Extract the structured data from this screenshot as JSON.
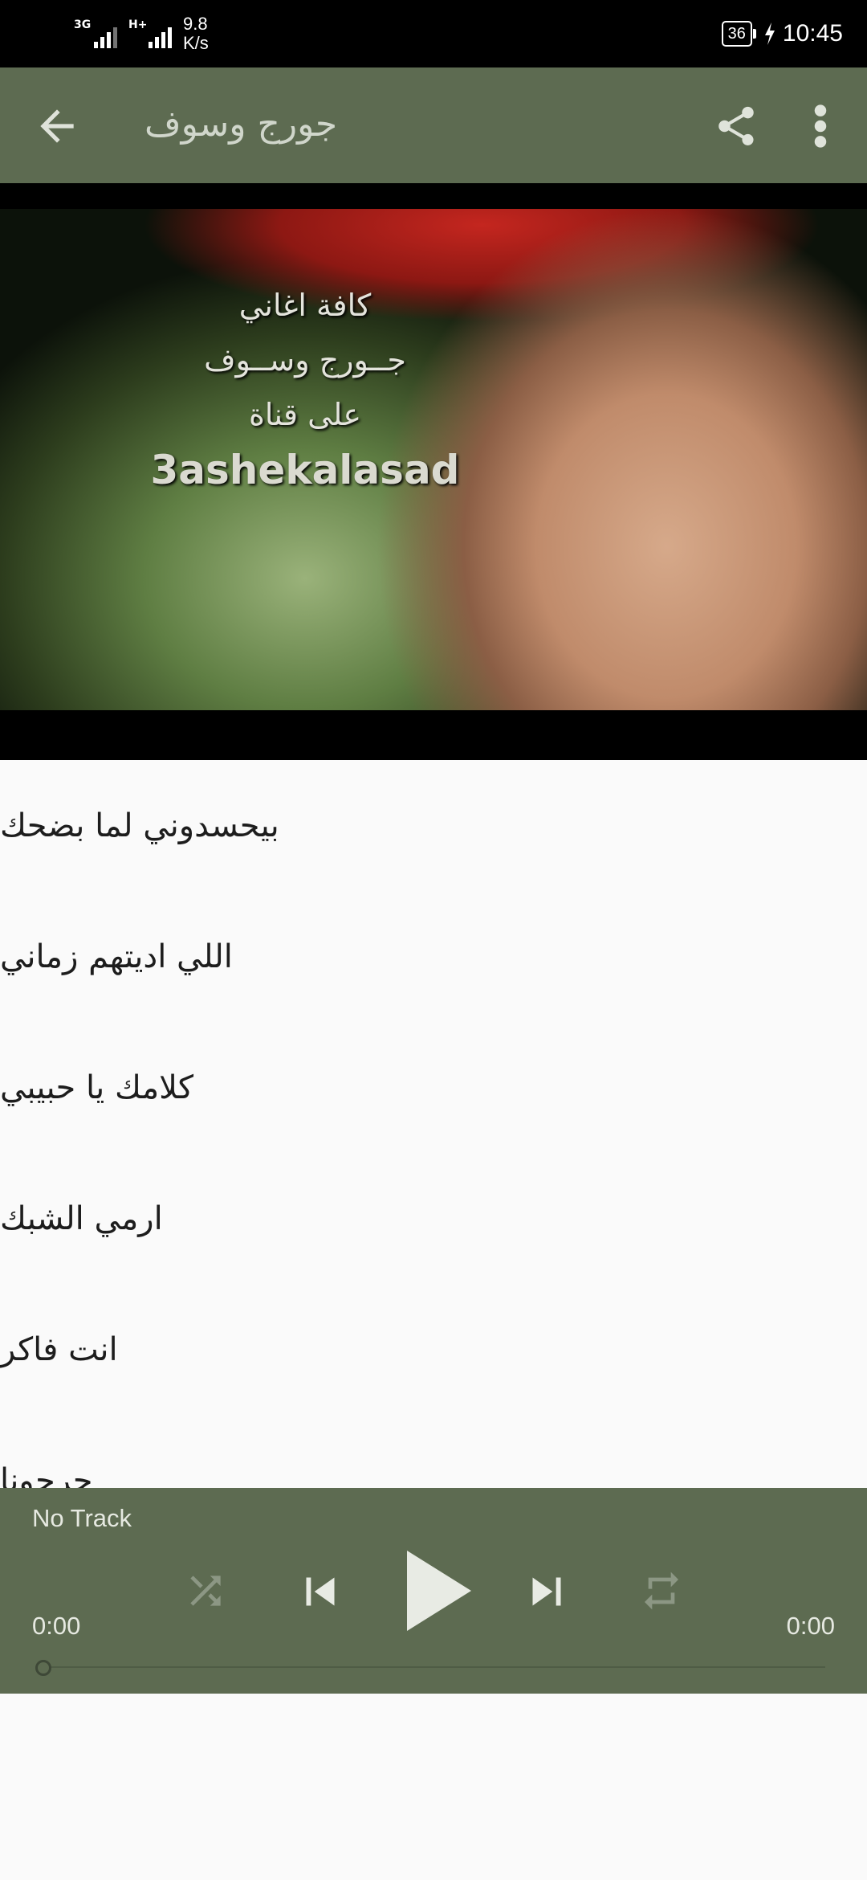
{
  "status_bar": {
    "signal1": "3G",
    "signal2": "H+",
    "net_speed_value": "9.8",
    "net_speed_unit": "K/s",
    "battery": "36",
    "time": "10:45"
  },
  "app_bar": {
    "title": "جورج وسوف",
    "icons": [
      "back-arrow-icon",
      "share-icon",
      "more-vert-icon"
    ]
  },
  "hero": {
    "line1": "كافة اغاني",
    "line2": "جــورج وســوف",
    "line3": "على قناة",
    "channel": "3ashekalasad"
  },
  "songs": [
    "بيحسدوني لما بضحك",
    "اللي اديتهم زماني",
    "كلامك يا حبيبي",
    "ارمي الشبك",
    "انت فاكر",
    "جرحونا"
  ],
  "player": {
    "track": "No Track",
    "current_time": "0:00",
    "duration": "0:00",
    "progress": 0,
    "icons": [
      "shuffle-icon",
      "skip-previous-icon",
      "play-icon",
      "skip-next-icon",
      "repeat-icon"
    ]
  },
  "colors": {
    "primary": "#5d6b51",
    "background": "#fafafa",
    "text": "#1d1d1d"
  }
}
